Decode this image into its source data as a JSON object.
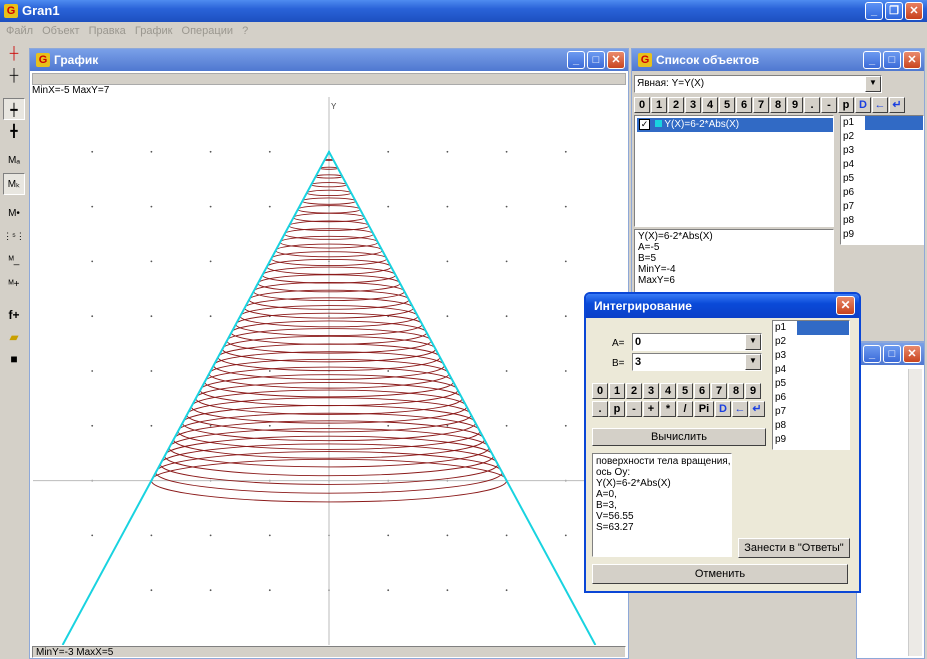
{
  "app": {
    "title": "Gran1"
  },
  "menu": [
    "Файл",
    "Объект",
    "Правка",
    "График",
    "Операции",
    "?"
  ],
  "graph_window": {
    "title": "График",
    "top_status": "MinX=-5  MaxY=7",
    "bottom_status": "MinY=-3  MaxX=5",
    "axis_y_label": "Y"
  },
  "objects_window": {
    "title": "Список объектов",
    "type_combo": "Явная: Y=Y(X)",
    "keys": [
      "0",
      "1",
      "2",
      "3",
      "4",
      "5",
      "6",
      "7",
      "8",
      "9",
      ".",
      "-",
      "p",
      "D",
      "←",
      "↵"
    ],
    "object_item": "Y(X)=6-2*Abs(X)",
    "params": [
      "p1",
      "p2",
      "p3",
      "p4",
      "p5",
      "p6",
      "p7",
      "p8",
      "p9"
    ],
    "info_lines": [
      "Y(X)=6-2*Abs(X)",
      "A=-5",
      "B=5",
      "MinY=-4",
      "MaxY=6"
    ]
  },
  "dialog": {
    "title": "Интегрирование",
    "a_label": "A=",
    "a_value": "0",
    "b_label": "B=",
    "b_value": "3",
    "keys_row1": [
      "0",
      "1",
      "2",
      "3",
      "4",
      "5",
      "6",
      "7",
      "8",
      "9"
    ],
    "keys_row2": [
      ".",
      "p",
      "-",
      "+",
      "*",
      "/",
      "Pi",
      "D",
      "←",
      "↵"
    ],
    "compute_button": "Вычислить",
    "params": [
      "p1",
      "p2",
      "p3",
      "p4",
      "p5",
      "p6",
      "p7",
      "p8",
      "p9"
    ],
    "result_lines": [
      "поверхности тела вращения,",
      "ось Oy:",
      "Y(X)=6-2*Abs(X)",
      "A=0,",
      "B=3,",
      "V=56.55",
      "S=63.27"
    ],
    "save_button": "Занести в \"Ответы\"",
    "cancel_button": "Отменить"
  },
  "chart_data": {
    "type": "line",
    "title": "",
    "xlim": [
      -5,
      5
    ],
    "ylim": [
      -3,
      7
    ],
    "series": [
      {
        "x": [
          -4.5,
          0,
          4.5
        ],
        "y": [
          -3,
          6,
          -3
        ],
        "color": "#19d3e0"
      }
    ],
    "surface": {
      "x_from": 0,
      "x_to": 3,
      "color": "#8b1a1a"
    }
  },
  "colors": {
    "curve": "#19d3e0",
    "surface": "#8b1a1a",
    "title_blue": "#2a63d8"
  }
}
